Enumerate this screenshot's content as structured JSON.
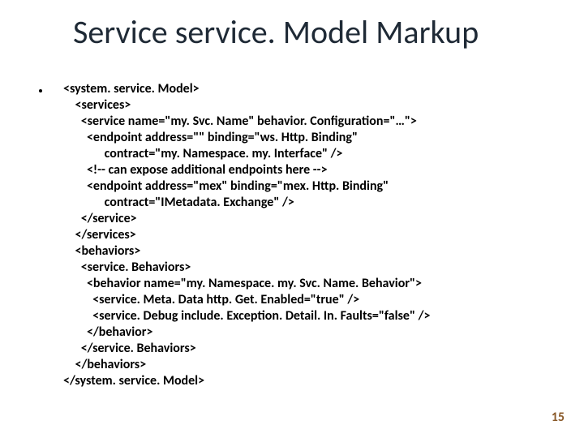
{
  "title": "Service service. Model Markup",
  "code_lines": [
    "<system. service. Model>",
    "    <services>",
    "      <service name=\"my. Svc. Name\" behavior. Configuration=\"…\">",
    "        <endpoint address=\"\" binding=\"ws. Http. Binding\"",
    "              contract=\"my. Namespace. my. Interface\" />",
    "        <!-- can expose additional endpoints here -->",
    "        <endpoint address=\"mex\" binding=\"mex. Http. Binding\"",
    "              contract=\"IMetadata. Exchange\" />",
    "      </service>",
    "    </services>",
    "    <behaviors>",
    "      <service. Behaviors>",
    "        <behavior name=\"my. Namespace. my. Svc. Name. Behavior\">",
    "          <service. Meta. Data http. Get. Enabled=\"true\" />",
    "          <service. Debug include. Exception. Detail. In. Faults=\"false\" />",
    "        </behavior>",
    "      </service. Behaviors>",
    "    </behaviors>",
    "</system. service. Model>"
  ],
  "page_number": "15"
}
